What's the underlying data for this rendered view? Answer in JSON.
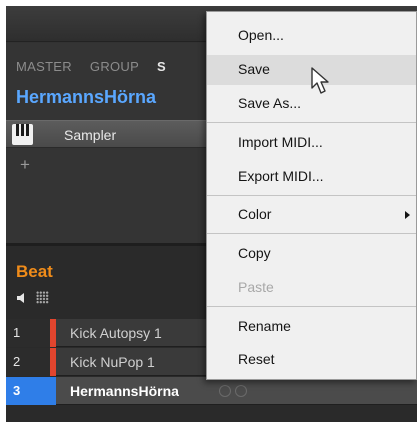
{
  "channel": {
    "tabs": [
      "MASTER",
      "GROUP",
      "S"
    ],
    "name": "HermannsHörna",
    "plugin": {
      "icon": "piano-keys-icon",
      "label": "Sampler"
    },
    "add_label": "+"
  },
  "group": {
    "name": "Beat",
    "icons": [
      "speaker-icon",
      "pad-grid-icon"
    ],
    "pads": [
      {
        "number": "1",
        "name": "Kick Autopsy 1",
        "color": "#e2452e",
        "selected": false
      },
      {
        "number": "2",
        "name": "Kick NuPop 1",
        "color": "#e2452e",
        "selected": false
      },
      {
        "number": "3",
        "name": "HermannsHörna",
        "color": "#2f7ee8",
        "selected": true
      }
    ]
  },
  "menu": {
    "items": [
      {
        "label": "Open...",
        "enabled": true
      },
      {
        "label": "Save",
        "enabled": true,
        "hover": true
      },
      {
        "label": "Save As...",
        "enabled": true
      },
      {
        "label": "Import MIDI...",
        "enabled": true
      },
      {
        "label": "Export MIDI...",
        "enabled": true
      },
      {
        "label": "Color",
        "enabled": true,
        "submenu": true
      },
      {
        "label": "Copy",
        "enabled": true
      },
      {
        "label": "Paste",
        "enabled": false
      },
      {
        "label": "Rename",
        "enabled": true
      },
      {
        "label": "Reset",
        "enabled": true
      }
    ]
  },
  "colors": {
    "accent_blue": "#2f7ee8",
    "group_orange": "#f08c1a",
    "pad_red": "#e2452e",
    "channel_blue": "#5aa7ff"
  }
}
